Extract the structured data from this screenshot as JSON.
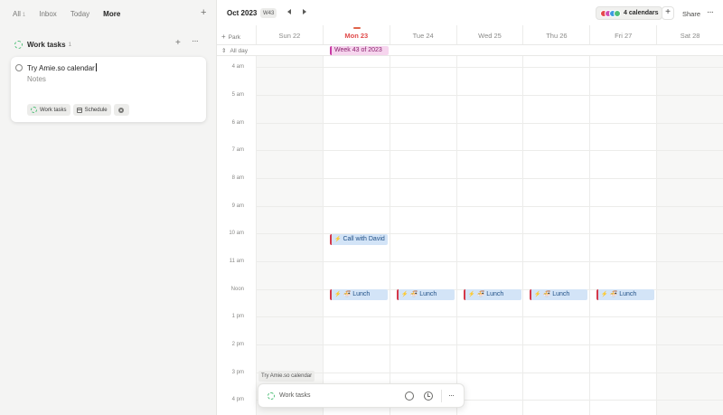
{
  "nav": {
    "tabs": [
      {
        "label": "All",
        "count": "1"
      },
      {
        "label": "Inbox"
      },
      {
        "label": "Today"
      },
      {
        "label": "More"
      }
    ],
    "add": "+"
  },
  "task_list": {
    "title": "Work tasks",
    "count": "1",
    "add": "+",
    "more": "···",
    "ring_color": "#4fbf78"
  },
  "task_card": {
    "title": "Try Amie.so calendar",
    "notes": "Notes",
    "chips": {
      "list": "Work tasks",
      "schedule": "Schedule"
    }
  },
  "calendar": {
    "month": "Oct 2023",
    "week": "W43",
    "calendars_label": "4 calendars",
    "calendar_colors": [
      "#e5484d",
      "#d04fb3",
      "#3e9be0",
      "#4fbf78"
    ],
    "add": "+",
    "share": "Share",
    "more": "···",
    "park": "Park",
    "allday": "All day",
    "days": [
      {
        "label": "Sun 22"
      },
      {
        "label": "Mon 23",
        "today": true
      },
      {
        "label": "Tue 24"
      },
      {
        "label": "Wed 25"
      },
      {
        "label": "Thu 26"
      },
      {
        "label": "Fri 27"
      },
      {
        "label": "Sat 28"
      }
    ],
    "allday_event": "Week 43 of 2023",
    "hours": [
      "4 am",
      "5 am",
      "6 am",
      "7 am",
      "8 am",
      "9 am",
      "10 am",
      "11 am",
      "Noon",
      "1 pm",
      "2 pm",
      "3 pm",
      "4 pm"
    ],
    "events": [
      {
        "title": "Call with David",
        "emoji": "",
        "day": "Mon 23",
        "start": "10:00"
      },
      {
        "title": "Lunch",
        "emoji": "🍜",
        "day": "Mon 23",
        "start": "12:00"
      },
      {
        "title": "Lunch",
        "emoji": "🍜",
        "day": "Tue 24",
        "start": "12:00"
      },
      {
        "title": "Lunch",
        "emoji": "🍜",
        "day": "Wed 25",
        "start": "12:00"
      },
      {
        "title": "Lunch",
        "emoji": "🍜",
        "day": "Thu 26",
        "start": "12:00"
      },
      {
        "title": "Lunch",
        "emoji": "🍜",
        "day": "Fri 27",
        "start": "12:00"
      }
    ]
  },
  "drag_tooltip": "Try Amie.so calendar",
  "float_bar": {
    "list": "Work tasks",
    "more": "···"
  }
}
